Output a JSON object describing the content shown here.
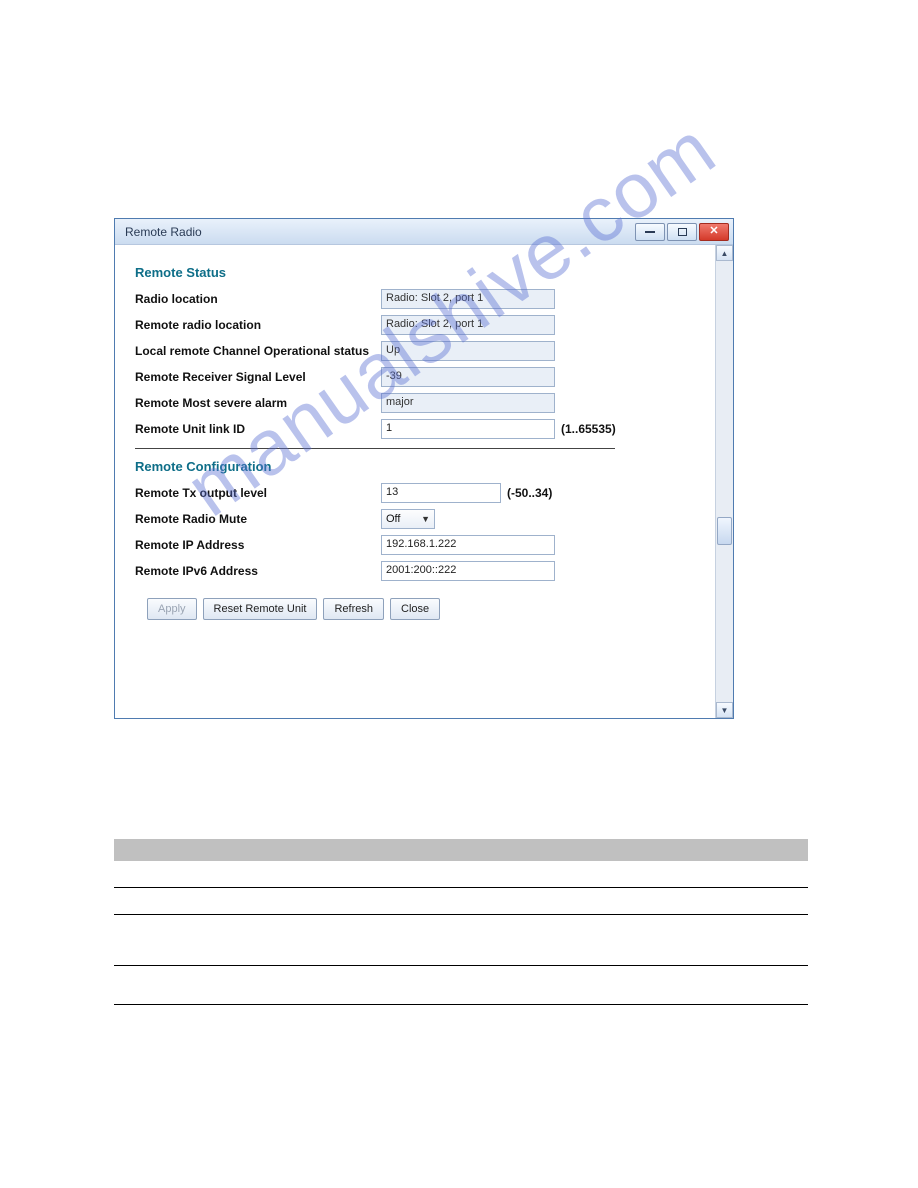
{
  "window": {
    "title": "Remote Radio"
  },
  "sections": {
    "status_title": "Remote Status",
    "config_title": "Remote Configuration"
  },
  "status": {
    "radio_location": {
      "label": "Radio location",
      "value": "Radio: Slot 2, port 1"
    },
    "remote_radio_location": {
      "label": "Remote radio location",
      "value": "Radio: Slot 2, port 1"
    },
    "channel_op_status": {
      "label": "Local remote Channel Operational status",
      "value": "Up"
    },
    "receiver_signal": {
      "label": "Remote Receiver Signal Level",
      "value": "-39"
    },
    "most_severe_alarm": {
      "label": "Remote Most severe alarm",
      "value": "major"
    },
    "unit_link_id": {
      "label": "Remote Unit link ID",
      "value": "1",
      "hint": "(1..65535)"
    }
  },
  "config": {
    "tx_output_level": {
      "label": "Remote Tx output level",
      "value": "13",
      "hint": "(-50..34)"
    },
    "radio_mute": {
      "label": "Remote Radio Mute",
      "value": "Off"
    },
    "ip_address": {
      "label": "Remote IP Address",
      "value": "192.168.1.222"
    },
    "ipv6_address": {
      "label": "Remote IPv6 Address",
      "value": "2001:200::222"
    }
  },
  "buttons": {
    "apply": "Apply",
    "reset": "Reset Remote Unit",
    "refresh": "Refresh",
    "close": "Close"
  },
  "watermark": "manualshive.com"
}
